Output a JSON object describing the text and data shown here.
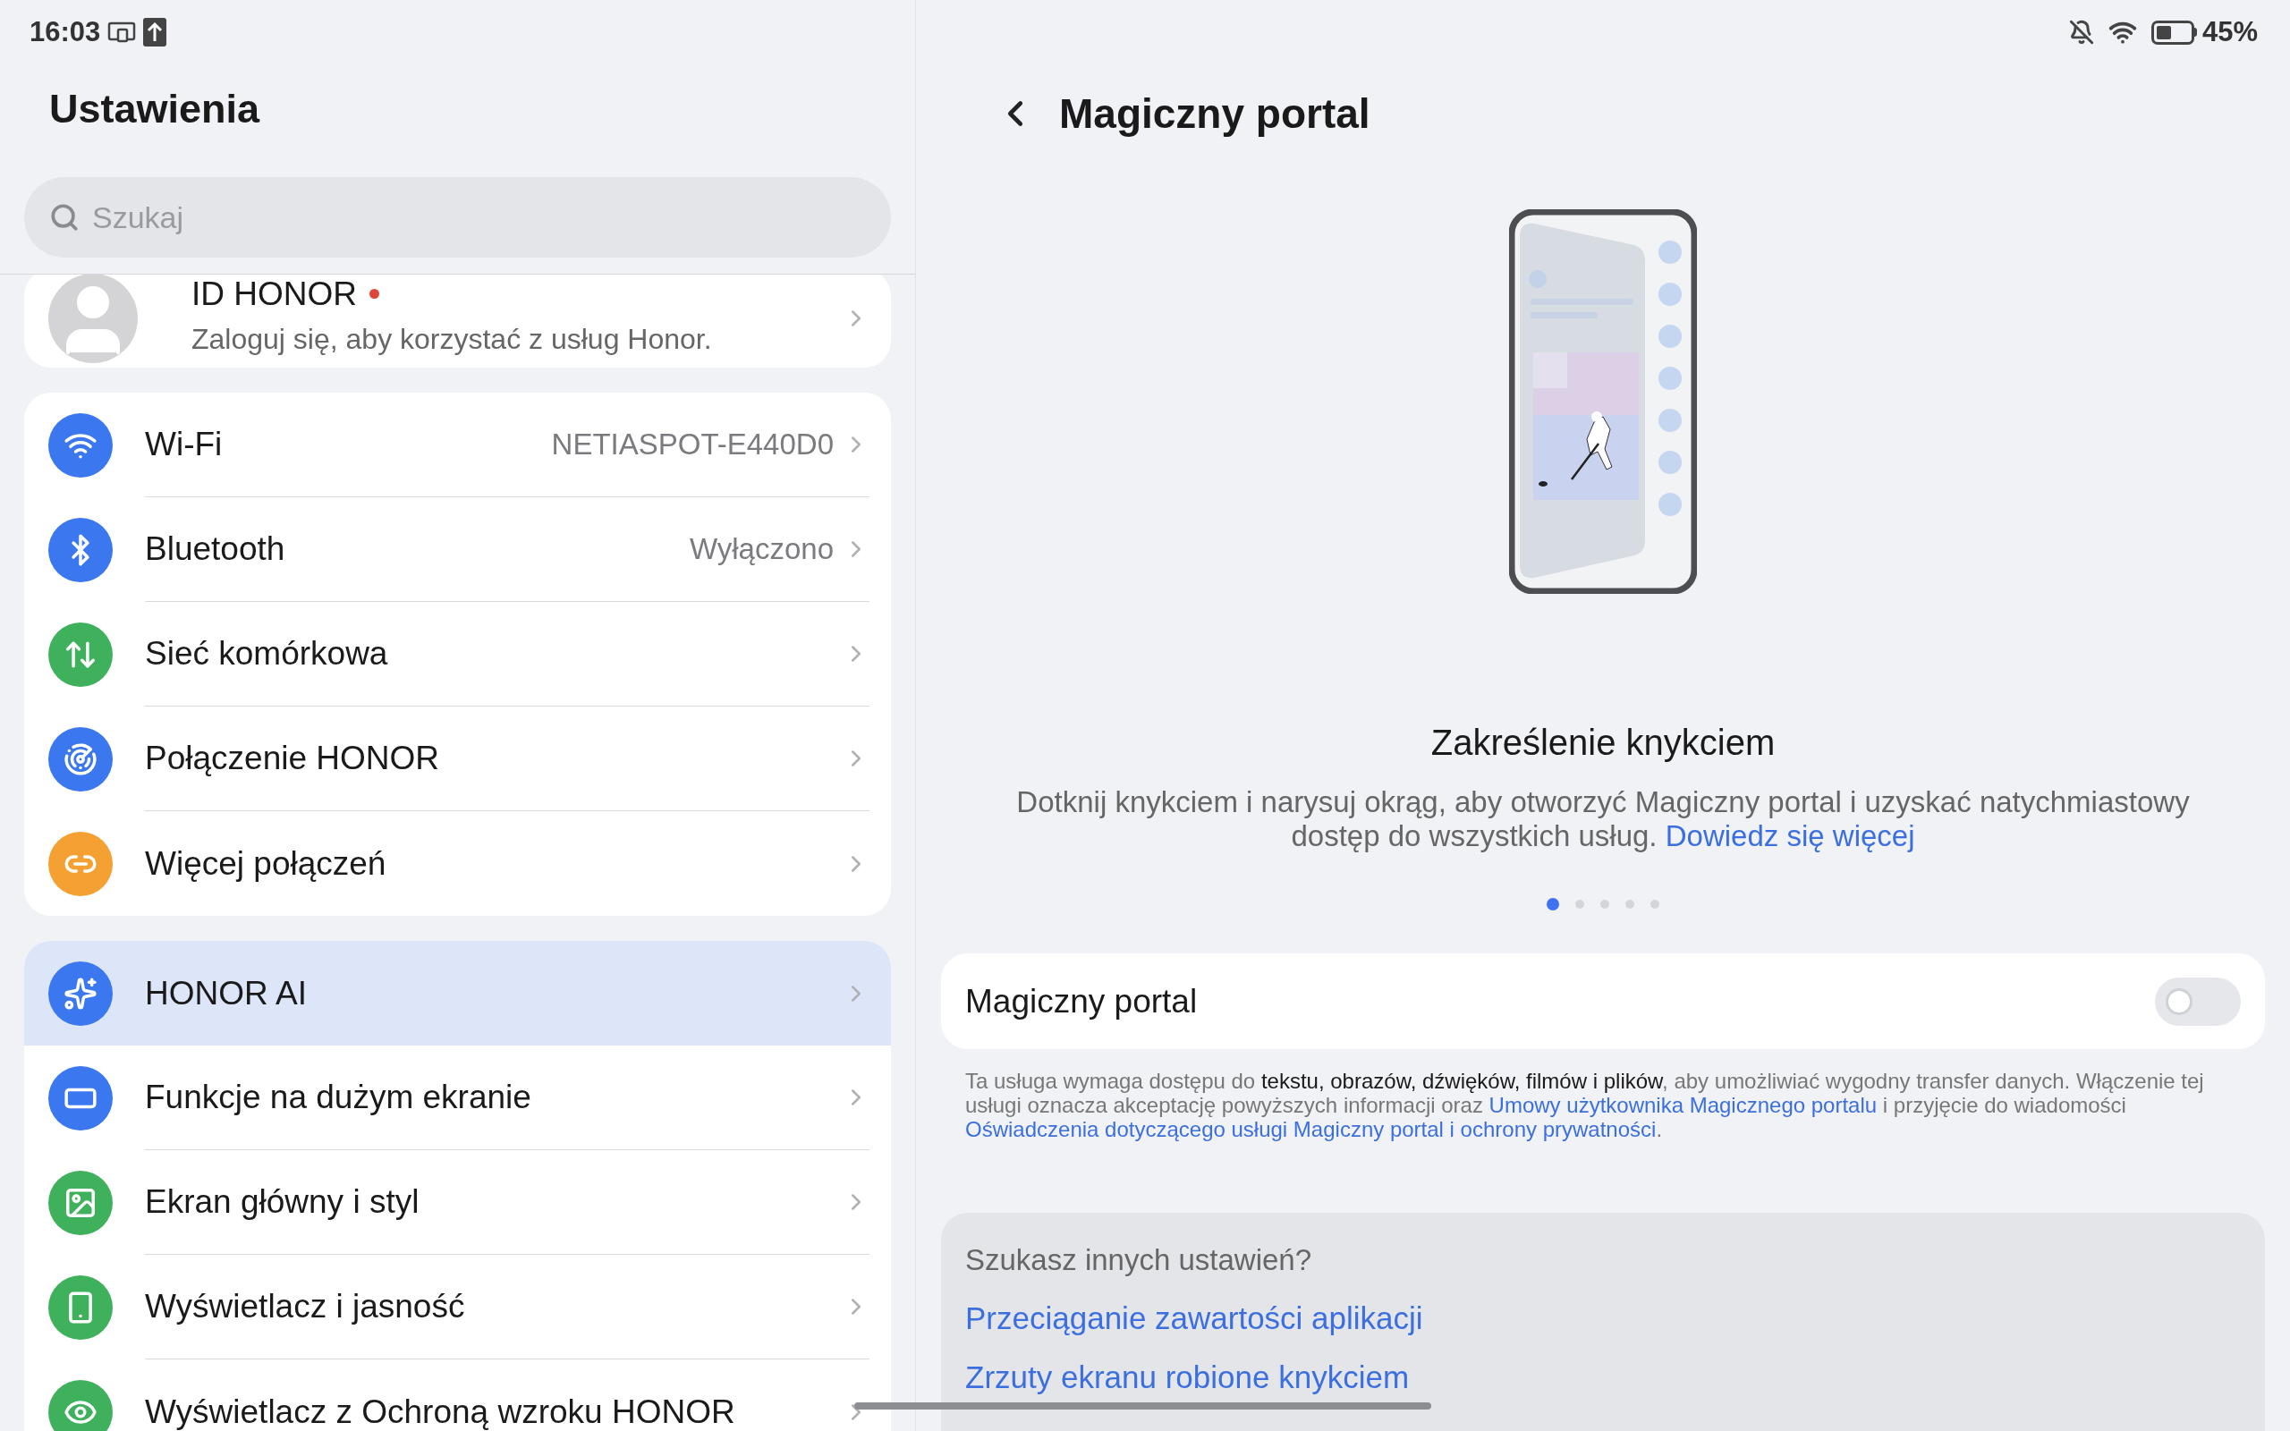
{
  "status_bar": {
    "time": "16:03",
    "battery": "45%"
  },
  "sidebar": {
    "title": "Ustawienia",
    "search": {
      "placeholder": "Szukaj"
    },
    "profile": {
      "title": "ID HONOR",
      "unread": true,
      "subtitle": "Zaloguj się, aby korzystać z usług Honor."
    },
    "groups": [
      [
        {
          "label": "Wi-Fi",
          "value": "NETIASPOT-E440D0",
          "color": "#3b78f0",
          "selected": false
        },
        {
          "label": "Bluetooth",
          "value": "Wyłączono",
          "color": "#3b78f0",
          "selected": false
        },
        {
          "label": "Sieć komórkowa",
          "color": "#3fb15c",
          "selected": false
        },
        {
          "label": "Połączenie HONOR",
          "color": "#3b78f0",
          "selected": false
        },
        {
          "label": "Więcej połączeń",
          "color": "#f4a032",
          "selected": false
        }
      ],
      [
        {
          "label": "HONOR AI",
          "color": "#3b78f0",
          "selected": true
        },
        {
          "label": "Funkcje na dużym ekranie",
          "color": "#3b78f0",
          "selected": false
        },
        {
          "label": "Ekran główny i styl",
          "color": "#3fb15c",
          "selected": false
        },
        {
          "label": "Wyświetlacz i jasność",
          "color": "#3fb15c",
          "selected": false
        },
        {
          "label": "Wyświetlacz z Ochroną wzroku HONOR",
          "color": "#3fb15c",
          "selected": false
        }
      ]
    ]
  },
  "detail": {
    "title": "Magiczny portal",
    "slide": {
      "title": "Zakreślenie knykciem",
      "description": "Dotknij knykciem i narysuj okrąg, aby otworzyć Magiczny portal i uzyskać natychmiastowy dostęp do wszystkich usług.",
      "link": "Dowiedz się więcej"
    },
    "pager": [
      {
        "selected": true
      },
      {
        "selected": false
      },
      {
        "selected": false
      },
      {
        "selected": false
      },
      {
        "selected": false
      }
    ],
    "toggle": {
      "label": "Magiczny portal",
      "on": false
    },
    "legal": [
      {
        "kind": "text",
        "text": "Ta usługa wymaga dostępu do "
      },
      {
        "kind": "bold",
        "text": "tekstu, obrazów, dźwięków, filmów i plików"
      },
      {
        "kind": "text",
        "text": ", aby umożliwiać wygodny transfer danych. Włączenie tej usługi oznacza akceptację powyższych informacji oraz "
      },
      {
        "kind": "link",
        "text": "Umowy użytkownika Magicznego portalu"
      },
      {
        "kind": "text",
        "text": " i przyjęcie do wiadomości "
      },
      {
        "kind": "link",
        "text": "Oświadczenia dotyczącego usługi Magiczny portal i ochrony prywatności"
      },
      {
        "kind": "text",
        "text": "."
      }
    ],
    "related": {
      "title": "Szukasz innych ustawień?",
      "links": [
        "Przeciąganie zawartości aplikacji",
        "Zrzuty ekranu robione knykciem"
      ]
    }
  }
}
